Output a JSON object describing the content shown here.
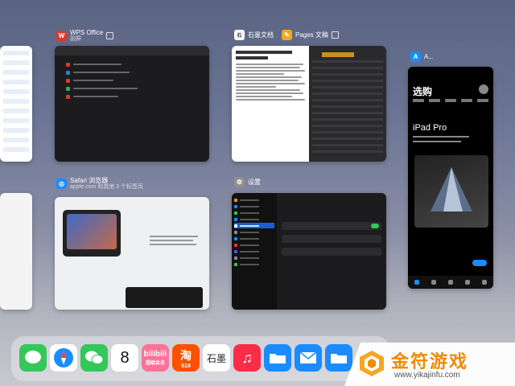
{
  "cards": {
    "wps": {
      "title": "WPS Office",
      "subtitle": "副屏"
    },
    "shimo_pages": {
      "title1": "石墨文档",
      "title2": "Pages 文稿"
    },
    "appstore": {
      "title": "A...",
      "heading": "选购",
      "product": "iPad Pro"
    },
    "safari": {
      "title": "Safari 浏览器",
      "subtitle": "apple.com 和其他 3 个标签页"
    },
    "settings": {
      "title": "设置"
    }
  },
  "dock": {
    "apps": [
      "信息",
      "Safari 浏览器",
      "微信",
      "日历",
      "哔哩哔哩",
      "淘宝",
      "石墨文档",
      "音乐",
      "文件夹",
      "邮件",
      "文件"
    ],
    "calendar_day": "8",
    "taobao_badge": "618",
    "bili_badge": "超级会员",
    "shimo_label": "石墨"
  },
  "watermark": {
    "brand": "金符游戏",
    "url": "www.yikajinfu.com"
  },
  "colors": {
    "wps_red": "#d93a2b",
    "pages_orange": "#f5a623",
    "appstore_blue": "#1a8cff",
    "messages_green": "#34c759",
    "music_red": "#fa2d48",
    "mail_blue": "#1a8cff"
  }
}
